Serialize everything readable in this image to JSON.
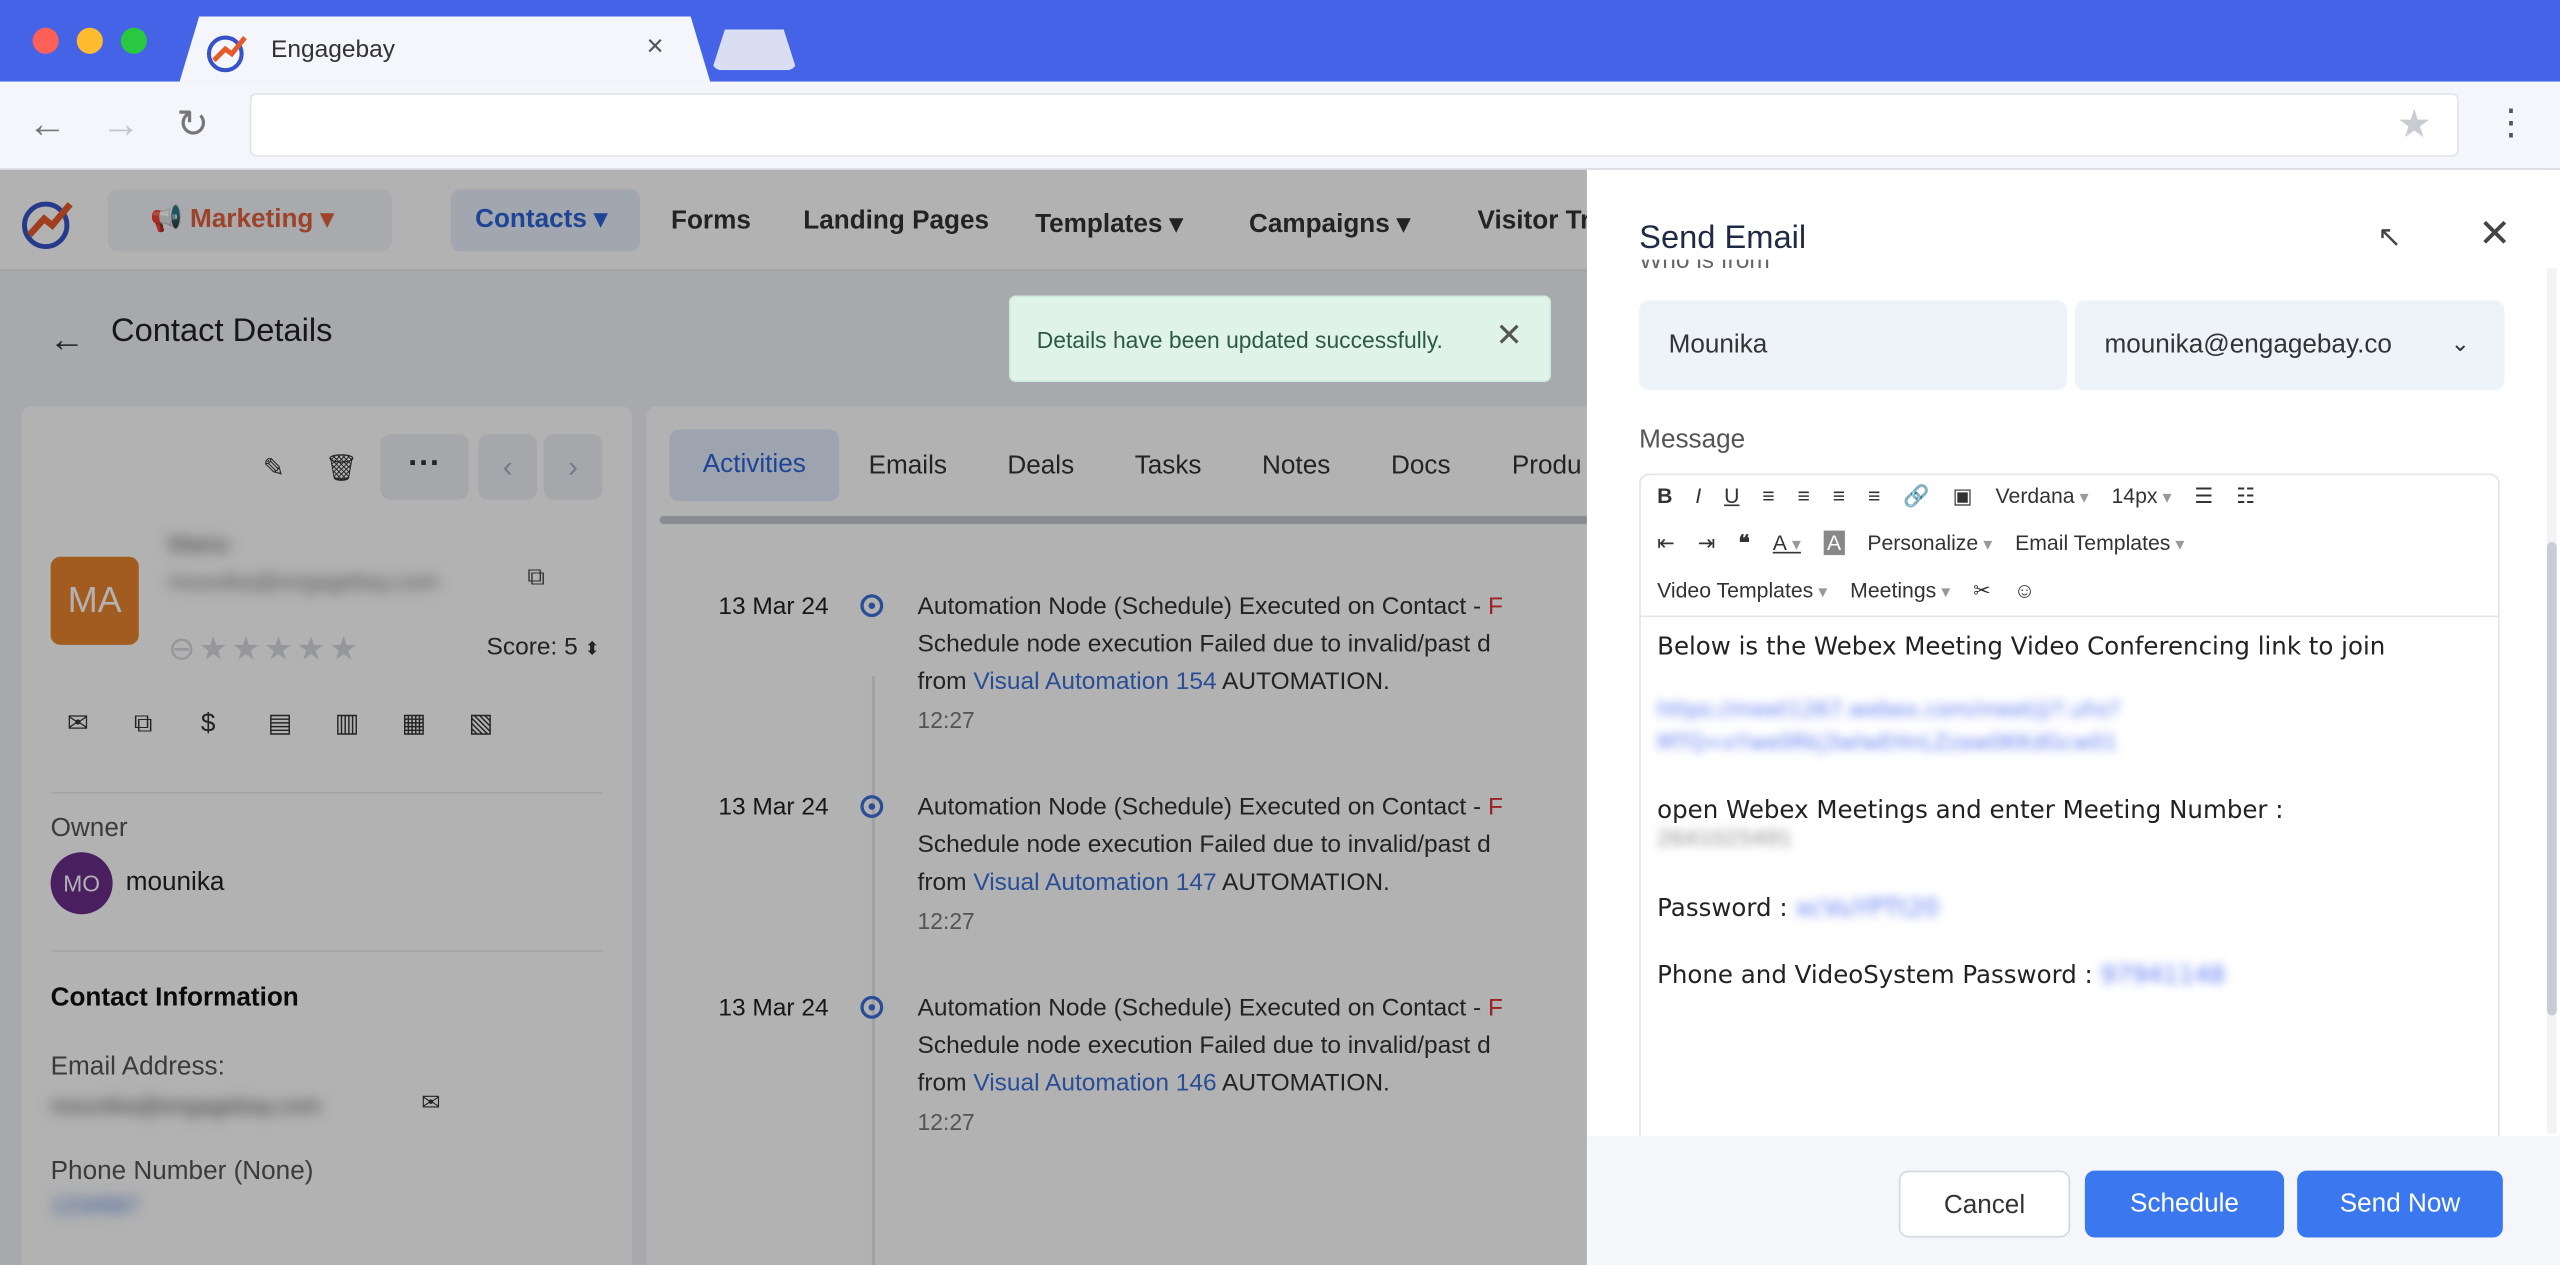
{
  "browser": {
    "tab_title": "Engagebay",
    "tab_close": "×",
    "colors": {
      "frame": "#4563e6",
      "toolbar": "#f4f6fb"
    }
  },
  "app": {
    "nav": {
      "marketing": "Marketing",
      "contacts": "Contacts",
      "links": [
        "Forms",
        "Landing Pages",
        "Templates",
        "Campaigns",
        "Visitor Tra"
      ]
    },
    "page_title": "Contact Details",
    "toast": "Details have been updated successfully.",
    "contact": {
      "initials": "MA",
      "name": "Manu",
      "email": "mounika@engagebay.com",
      "score": "Score: 5",
      "owner_label": "Owner",
      "owner_initials": "MO",
      "owner_name": "mounika",
      "section": "Contact Information",
      "email_label": "Email Address:",
      "phone_label": "Phone Number (None)",
      "phone_value": "1234567"
    },
    "feed_tabs": [
      "Activities",
      "Emails",
      "Deals",
      "Tasks",
      "Notes",
      "Docs",
      "Produ"
    ],
    "activities": [
      {
        "date": "13 Mar 24",
        "line1": "Automation Node (Schedule) Executed on Contact - ",
        "line1_tail": "F",
        "line2": "Schedule node execution Failed due to invalid/past d",
        "from": "from ",
        "link": "Visual Automation 154",
        "suffix": " AUTOMATION.",
        "time": "12:27"
      },
      {
        "date": "13 Mar 24",
        "line1": "Automation Node (Schedule) Executed on Contact - ",
        "line1_tail": "F",
        "line2": "Schedule node execution Failed due to invalid/past d",
        "from": "from ",
        "link": "Visual Automation 147",
        "suffix": " AUTOMATION.",
        "time": "12:27"
      },
      {
        "date": "13 Mar 24",
        "line1": "Automation Node (Schedule) Executed on Contact - ",
        "line1_tail": "F",
        "line2": "Schedule node execution Failed due to invalid/past d",
        "from": "from ",
        "link": "Visual Automation 146",
        "suffix": " AUTOMATION.",
        "time": "12:27"
      }
    ]
  },
  "email_panel": {
    "title": "Send Email",
    "from_label": "Who is from",
    "from_name": "Mounika",
    "from_email": "mounika@engagebay.co",
    "message_label": "Message",
    "toolbar": {
      "font": "Verdana",
      "size": "14px",
      "personalize": "Personalize",
      "email_templates": "Email Templates",
      "video_templates": "Video Templates",
      "meetings": "Meetings"
    },
    "body": {
      "line1": "Below is the Webex Meeting Video Conferencing link to join",
      "link_line1": "https://meet1267.webex.com/meet/j/?.uhs?",
      "link_line2": "MTQ=xYwe0Rkj3wlwEHnLZzaw0KKdGcw01",
      "meeting_label": "open Webex Meetings and enter Meeting Number :",
      "meeting_number": "2641025491",
      "password_label": "Password : ",
      "password_value": "xcVuYPTt20",
      "phone_pw_label": "Phone and VideoSystem Password : ",
      "phone_pw_value": "97941148"
    },
    "buttons": {
      "cancel": "Cancel",
      "schedule": "Schedule",
      "send": "Send Now"
    },
    "colors": {
      "primary": "#3b78f0"
    }
  }
}
